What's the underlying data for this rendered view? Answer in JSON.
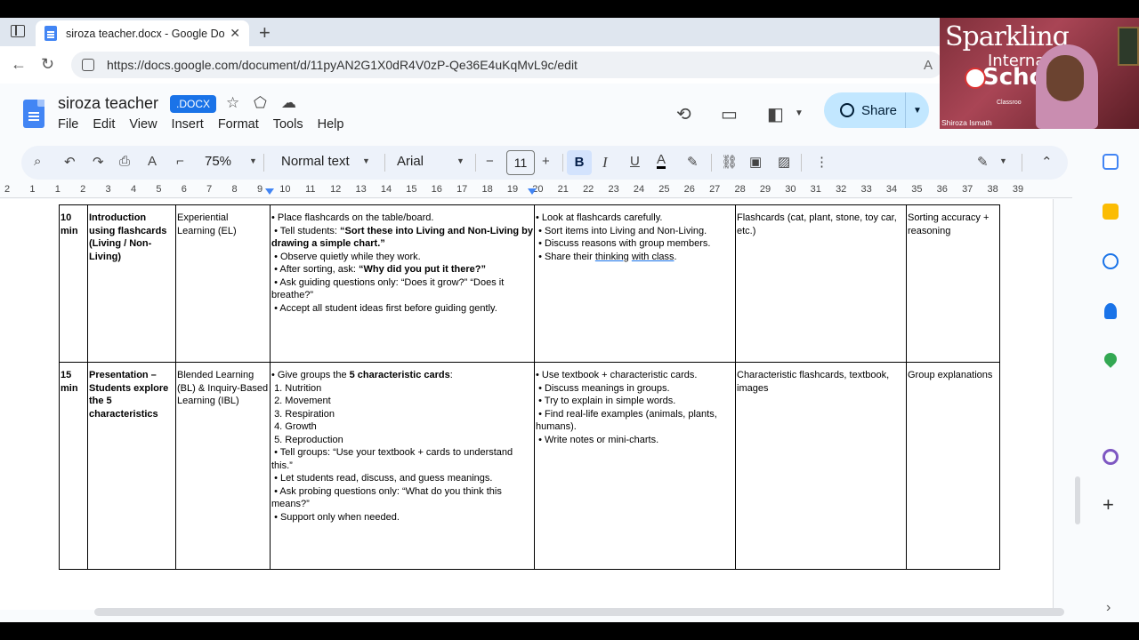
{
  "browser": {
    "tab_title": "siroza teacher.docx - Google Docs",
    "url": "https://docs.google.com/document/d/11pyAN2G1X0dR4V0zP-Qe36E4uKqMvL9c/edit"
  },
  "docs": {
    "title": "siroza teacher",
    "badge": ".DOCX",
    "menu": [
      "File",
      "Edit",
      "View",
      "Insert",
      "Format",
      "Tools",
      "Help"
    ],
    "share_label": "Share"
  },
  "toolbar": {
    "zoom": "75%",
    "style": "Normal text",
    "font": "Arial",
    "font_size": "11"
  },
  "ruler": {
    "ticks": [
      "2",
      "1",
      "1",
      "2",
      "3",
      "4",
      "5",
      "6",
      "7",
      "8",
      "9",
      "10",
      "11",
      "12",
      "13",
      "14",
      "15",
      "16",
      "17",
      "18",
      "19",
      "20",
      "21",
      "22",
      "23",
      "24",
      "25",
      "26",
      "27",
      "28",
      "29",
      "30",
      "31",
      "32",
      "33",
      "34",
      "35",
      "36",
      "37",
      "38",
      "39"
    ]
  },
  "table": {
    "rows": [
      {
        "time": "10 min",
        "activity": "Introduction using flashcards (Living / Non-Living)",
        "method": "Experiential Learning (EL)",
        "teacher": [
          "• Place flashcards on the table/board.",
          " • Tell students: ",
          "“Sort these into Living and Non-Living by drawing a simple chart.”",
          " • Observe quietly while they work.",
          " • After sorting, ask: ",
          "“Why did you put it there?”",
          " • Ask guiding questions only: “Does it grow?” “Does it breathe?”",
          " • Accept all student ideas first before guiding gently."
        ],
        "student": [
          "• Look at flashcards carefully.",
          " • Sort items into Living and Non-Living.",
          " • Discuss reasons with group members.",
          " • Share their ",
          "thinking",
          "with class",
          "."
        ],
        "resources": "Flashcards (cat, plant, stone, toy car, etc.)",
        "assessment": "Sorting accuracy + reasoning"
      },
      {
        "time": "15 min",
        "activity": "Presentation – Students explore the 5 characteristics",
        "method": "Blended Learning (BL) & Inquiry-Based Learning (IBL)",
        "teacher": [
          "• Give groups the ",
          "5 characteristic cards",
          ":",
          " 1. Nutrition",
          " 2. Movement",
          " 3. Respiration",
          " 4. Growth",
          " 5. Reproduction",
          " • Tell groups: “Use your textbook + cards to understand this.”",
          " • Let students read, discuss, and guess meanings.",
          " • Ask probing questions only: “What do you think this means?”",
          " • Support only when needed."
        ],
        "student": [
          "• Use textbook + characteristic cards.",
          " • Discuss meanings in groups.",
          " • Try to explain in simple words.",
          " • Find real-life examples (animals, plants, humans).",
          " • Write notes or mini-charts."
        ],
        "resources": "Characteristic flashcards, textbook, images",
        "assessment": "Group explanations"
      }
    ]
  },
  "webcam": {
    "presenter_name": "Shiroza Ismath",
    "sign_text_1": "Sparkling",
    "sign_text_2": "Internati",
    "sign_text_3": "Scho",
    "board_text": "Classroo"
  },
  "colors": {
    "share_bg": "#c2e7ff",
    "badge_bg": "#1a73e8",
    "toolbar_bg": "#edf2fa",
    "bold_active": "#d3e3fd"
  }
}
